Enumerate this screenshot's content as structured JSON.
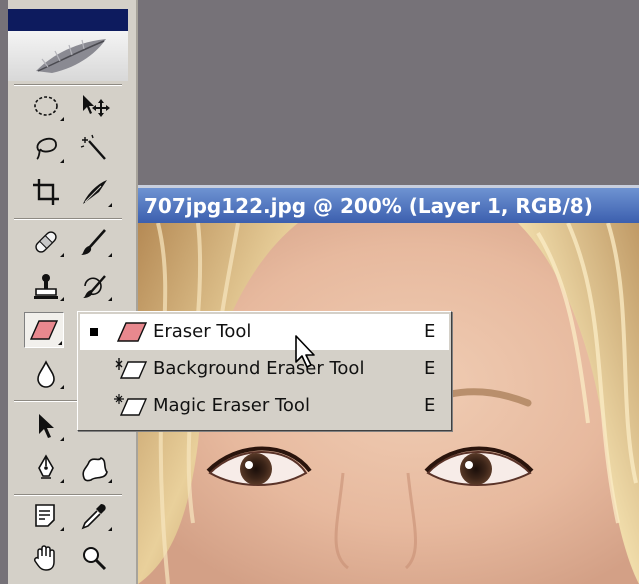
{
  "document": {
    "title": "707jpg122.jpg @ 200% (Layer 1, RGB/8)"
  },
  "toolbox": {
    "tools": [
      {
        "icon": "elliptical-marquee-icon"
      },
      {
        "icon": "move-icon"
      },
      {
        "icon": "lasso-icon"
      },
      {
        "icon": "magic-wand-icon"
      },
      {
        "icon": "crop-icon"
      },
      {
        "icon": "slice-icon"
      },
      {
        "icon": "healing-brush-icon"
      },
      {
        "icon": "brush-icon"
      },
      {
        "icon": "clone-stamp-icon"
      },
      {
        "icon": "history-brush-icon"
      },
      {
        "icon": "eraser-icon",
        "active": true
      },
      {
        "icon": "blur-icon"
      },
      {
        "icon": "path-selection-icon"
      },
      {
        "icon": "pen-icon"
      },
      {
        "icon": "custom-shape-icon"
      },
      {
        "icon": "notes-icon"
      },
      {
        "icon": "eyedropper-icon"
      },
      {
        "icon": "hand-icon"
      },
      {
        "icon": "zoom-icon"
      }
    ]
  },
  "flyout_menu": {
    "items": [
      {
        "label": "Eraser Tool",
        "shortcut": "E",
        "selected": true,
        "icon": "eraser-icon"
      },
      {
        "label": "Background Eraser Tool",
        "shortcut": "E",
        "selected": false,
        "icon": "background-eraser-icon"
      },
      {
        "label": "Magic Eraser Tool",
        "shortcut": "E",
        "selected": false,
        "icon": "magic-eraser-icon"
      }
    ]
  },
  "colors": {
    "workspace": "#767278",
    "toolbox": "#d4d0c8",
    "title_bar": "#3c5fae",
    "menu_highlight": "#ffffff",
    "eraser": "#e8888e"
  }
}
